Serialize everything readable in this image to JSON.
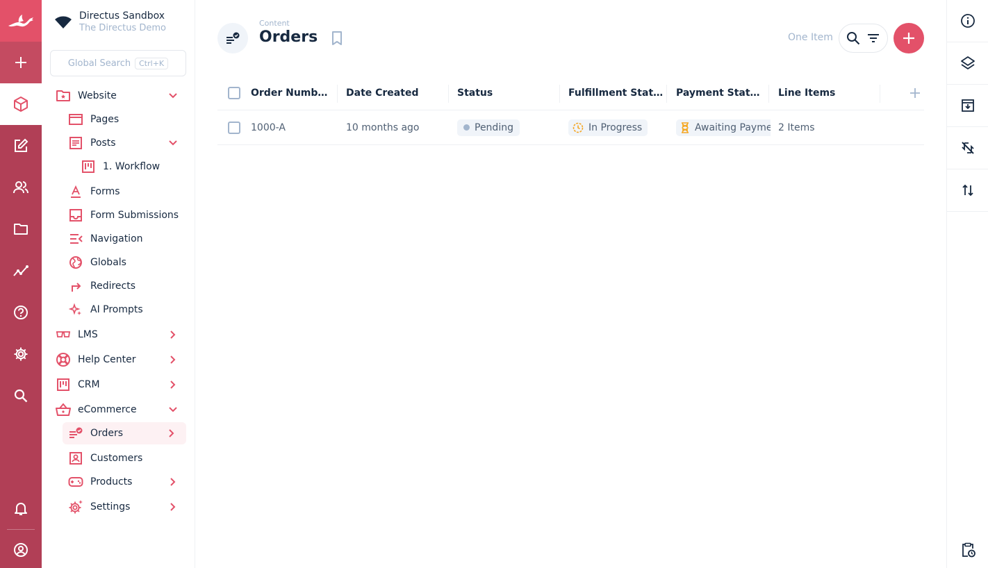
{
  "project": {
    "name": "Directus Sandbox",
    "subtitle": "The Directus Demo"
  },
  "search": {
    "placeholder": "Global Search",
    "shortcut": "Ctrl+K"
  },
  "nav": {
    "website": "Website",
    "pages": "Pages",
    "posts": "Posts",
    "workflow": "1. Workflow",
    "forms": "Forms",
    "form_submissions": "Form Submissions",
    "navigation": "Navigation",
    "globals": "Globals",
    "redirects": "Redirects",
    "ai_prompts": "AI Prompts",
    "lms": "LMS",
    "help_center": "Help Center",
    "crm": "CRM",
    "ecommerce": "eCommerce",
    "orders": "Orders",
    "customers": "Customers",
    "products": "Products",
    "settings": "Settings"
  },
  "header": {
    "breadcrumb": "Content",
    "title": "Orders",
    "item_count": "One Item"
  },
  "table": {
    "columns": [
      "Order Numb…",
      "Date Created",
      "Status",
      "Fulfillment Stat…",
      "Payment Stat…",
      "Line Items"
    ],
    "rows": [
      {
        "order_number": "1000-A",
        "date_created": "10 months ago",
        "status": "Pending",
        "fulfillment": "In Progress",
        "payment": "Awaiting Paymen",
        "line_items": "2 Items"
      }
    ]
  },
  "colors": {
    "accent": "#e35169",
    "module_bar": "#b13f56",
    "text": "#172940",
    "muted": "#a2b5cd"
  }
}
